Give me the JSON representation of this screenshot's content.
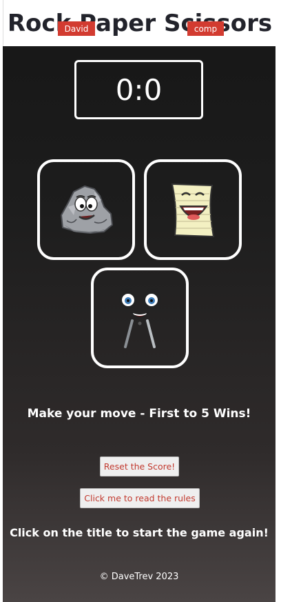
{
  "header": {
    "title": "Rock Paper Scissors"
  },
  "scoreboard": {
    "user_label": "David",
    "comp_label": "comp",
    "score": "0:0",
    "badge_color": "#d23b30"
  },
  "choices": [
    {
      "name": "rock",
      "icon": "rock-character-icon"
    },
    {
      "name": "paper",
      "icon": "paper-character-icon"
    },
    {
      "name": "scissors",
      "icon": "scissors-character-icon"
    }
  ],
  "status": {
    "message": "Make your move - First to 5 Wins!"
  },
  "buttons": {
    "reset_label": "Reset the Score!",
    "rules_label": "Click me to read the rules"
  },
  "hint": {
    "restart_text": "Click on the title to start the game again!"
  },
  "footer": {
    "copyright": "© DaveTrev 2023"
  }
}
